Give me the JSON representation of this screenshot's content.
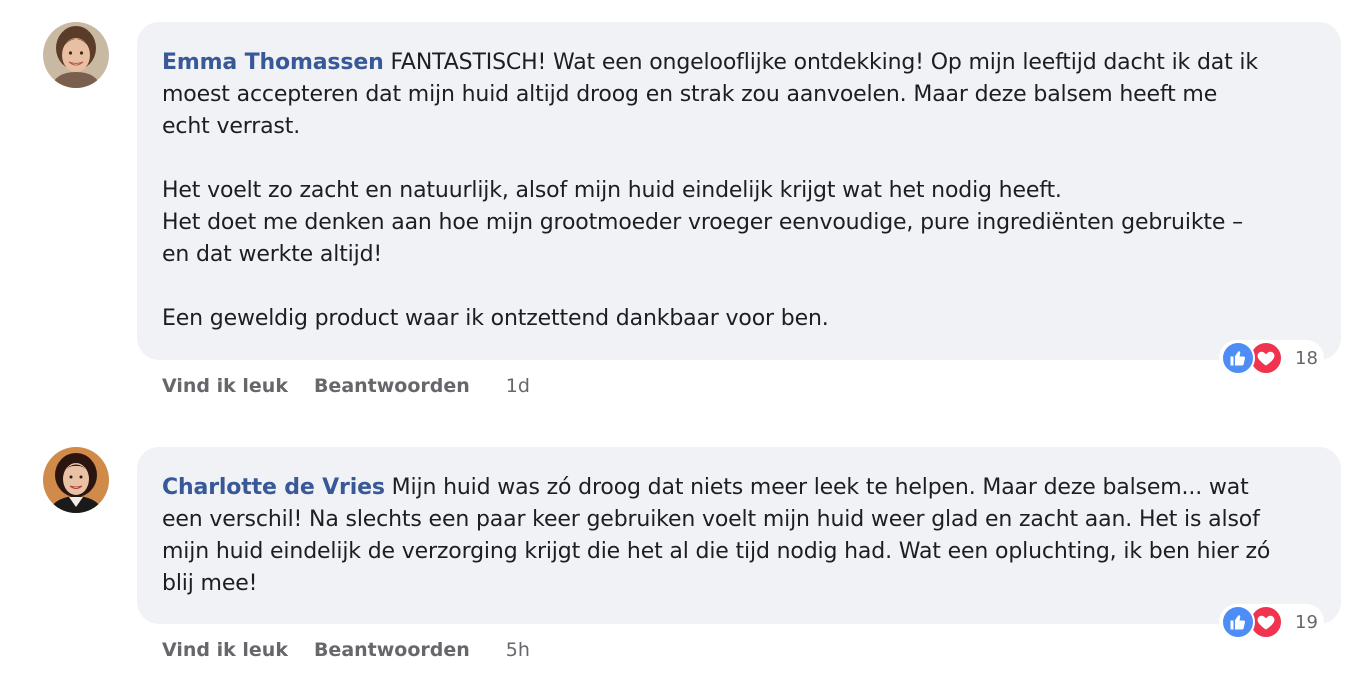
{
  "comments": [
    {
      "author": "Emma Thomassen",
      "text": " FANTASTISCH! Wat een ongelooflijke ontdekking! Op mijn leeftijd dacht ik dat ik\nmoest accepteren dat mijn huid altijd droog en strak zou aanvoelen. Maar deze balsem heeft me\necht verrast.\n\nHet voelt zo zacht en natuurlijk, alsof mijn huid eindelijk krijgt wat het nodig heeft.\nHet doet me denken aan hoe mijn grootmoeder vroeger eenvoudige, pure ingrediënten gebruikte –\nen dat werkte altijd!\n\nEen geweldig product waar ik ontzettend dankbaar voor ben.",
      "reaction_count": "18",
      "like_label": "Vind ik leuk",
      "reply_label": "Beantwoorden",
      "time": "1d",
      "avatar_icon": "avatar-photo-woman-smiling"
    },
    {
      "author": "Charlotte de Vries",
      "text": " Mijn huid was zó droog dat niets meer leek te helpen. Maar deze balsem... wat\neen verschil! Na slechts een paar keer gebruiken voelt mijn huid weer glad en zacht aan. Het is alsof\nmijn huid eindelijk de verzorging krijgt die het al die tijd nodig had. Wat een opluchting, ik ben hier zó\nblij mee!",
      "reaction_count": "19",
      "like_label": "Vind ik leuk",
      "reply_label": "Beantwoorden",
      "time": "5h",
      "avatar_icon": "avatar-photo-woman-dark-hair"
    }
  ],
  "colors": {
    "author": "#385898",
    "bubble": "#f0f2f5",
    "like": "#4e8df5",
    "love": "#f0334f",
    "muted": "#65676b"
  },
  "icons": {
    "like": "thumbs-up-icon",
    "love": "heart-icon"
  }
}
